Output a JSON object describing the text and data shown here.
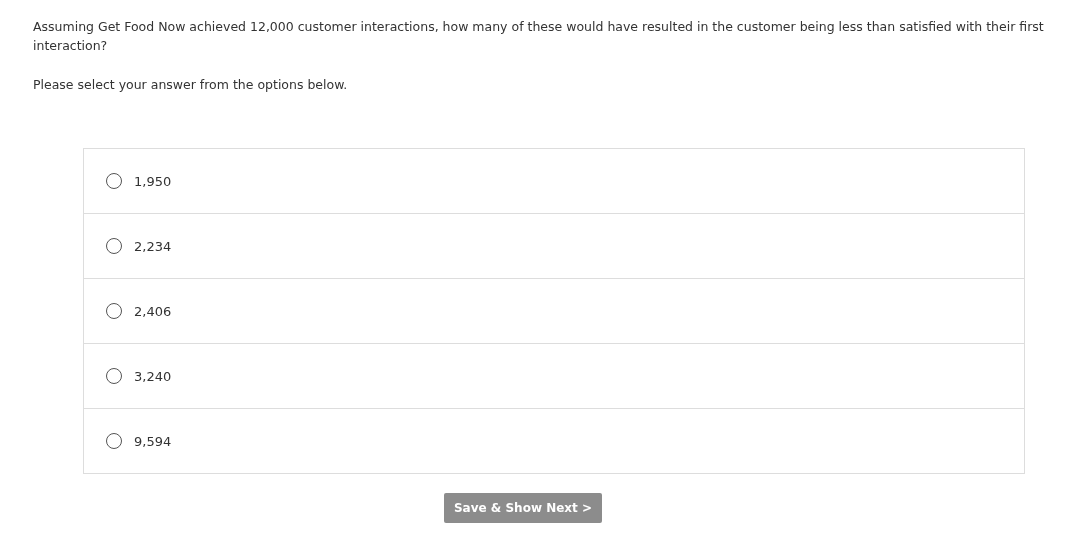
{
  "question": "Assuming Get Food Now achieved 12,000 customer interactions, how many of these would have resulted in the customer being less than satisfied with their first interaction?",
  "instruction": "Please select your answer from the options below.",
  "options": [
    {
      "label": "1,950",
      "selected": false
    },
    {
      "label": "2,234",
      "selected": false
    },
    {
      "label": "2,406",
      "selected": false
    },
    {
      "label": "3,240",
      "selected": false
    },
    {
      "label": "9,594",
      "selected": false
    }
  ],
  "button": "Save & Show Next >"
}
